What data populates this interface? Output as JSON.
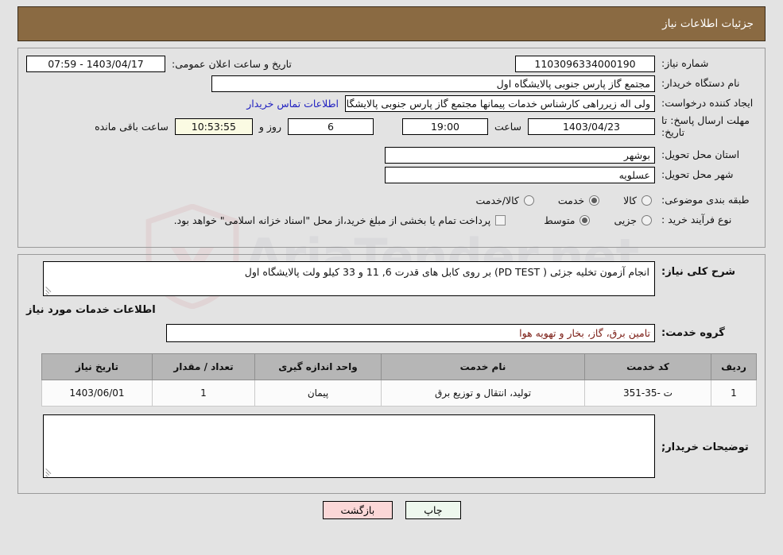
{
  "header": {
    "title": "جزئیات اطلاعات نیاز"
  },
  "watermark": {
    "text": "AriaTender.net"
  },
  "form": {
    "need_number_label": "شماره نیاز:",
    "need_number": "1103096334000190",
    "announce_label": "تاریخ و ساعت اعلان عمومی:",
    "announce_value": "1403/04/17 - 07:59",
    "buyer_org_label": "نام دستگاه خریدار:",
    "buyer_org": "مجتمع گاز پارس جنوبی  پالایشگاه اول",
    "creator_label": "ایجاد کننده درخواست:",
    "creator": "ولی اله زیرراهی کارشناس خدمات پیمانها مجتمع گاز پارس جنوبی  پالایشگاه اول",
    "contact_link": "اطلاعات تماس خریدار",
    "deadline_label": "مهلت ارسال پاسخ: تا تاریخ:",
    "deadline_date": "1403/04/23",
    "hour_label": "ساعت",
    "deadline_time": "19:00",
    "remaining_days": "6",
    "days_and_label": "روز و",
    "remaining_time": "10:53:55",
    "remaining_suffix": "ساعت باقی مانده",
    "province_label": "استان محل تحویل:",
    "province": "بوشهر",
    "city_label": "شهر محل تحویل:",
    "city": "عسلویه",
    "category_label": "طبقه بندی موضوعی:",
    "category_options": [
      {
        "label": "کالا",
        "selected": false
      },
      {
        "label": "خدمت",
        "selected": true
      },
      {
        "label": "کالا/خدمت",
        "selected": false
      }
    ],
    "process_label": "نوع فرآیند خرید :",
    "process_options": [
      {
        "label": "جزیی",
        "selected": false
      },
      {
        "label": "متوسط",
        "selected": true
      }
    ],
    "treasury_checkbox_label": "پرداخت تمام یا بخشی از مبلغ خرید،از محل \"اسناد خزانه اسلامی\" خواهد بود.",
    "treasury_checked": false
  },
  "details": {
    "description_label": "شرح کلی نیاز:",
    "description": "انجام آزمون تخلیه جزئی ( PD  TEST) بر روی کابل های قدرت 6, 11 و  33 کیلو ولت  پالایشگاه اول",
    "services_heading": "اطلاعات خدمات مورد نیاز",
    "service_group_label": "گروه خدمت:",
    "service_group": "تامین برق، گاز، بخار و تهویه هوا",
    "buyer_notes_label": "توضیحات خریدار;",
    "buyer_notes": ""
  },
  "table": {
    "columns": [
      "ردیف",
      "کد خدمت",
      "نام خدمت",
      "واحد اندازه گیری",
      "تعداد / مقدار",
      "تاریخ نیاز"
    ],
    "rows": [
      {
        "row_no": "1",
        "service_code": "ت -35-351",
        "service_name": "تولید، انتقال و توزیع برق",
        "unit": "پیمان",
        "quantity": "1",
        "need_date": "1403/06/01"
      }
    ]
  },
  "footer": {
    "print_label": "چاپ",
    "back_label": "بازگشت"
  }
}
